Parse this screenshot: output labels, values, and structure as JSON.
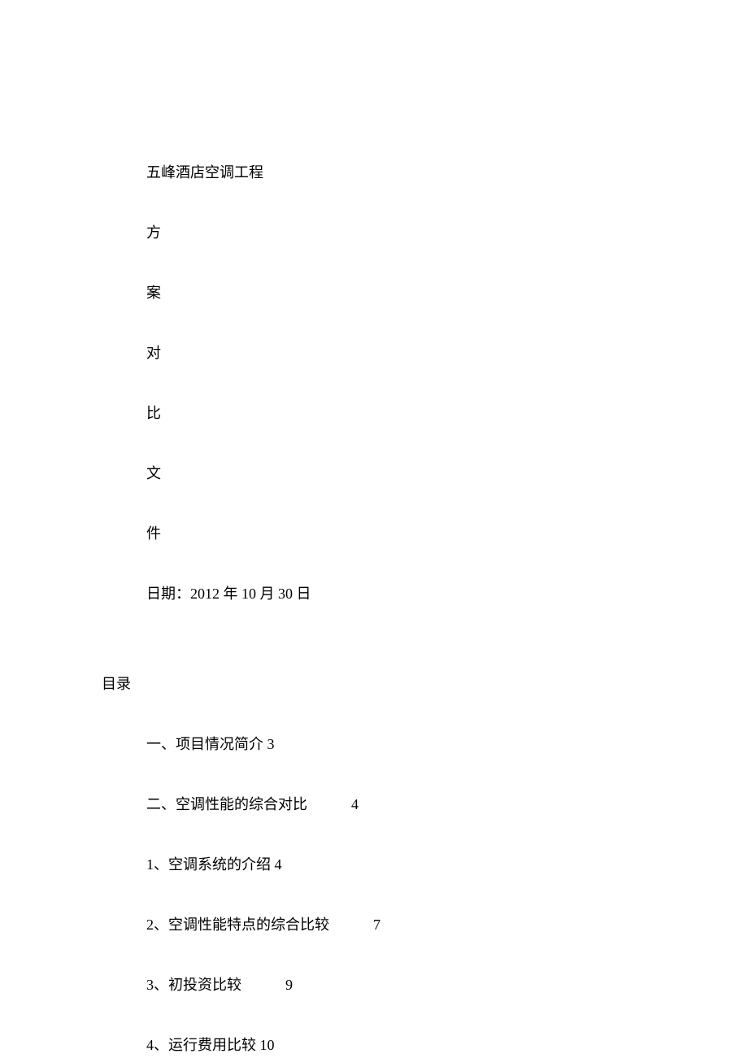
{
  "title": "五峰酒店空调工程",
  "vertical_chars": [
    "方",
    "案",
    "对",
    "比",
    "文",
    "件"
  ],
  "date_label": "日期：",
  "date_value": "2012 年 10 月 30 日",
  "toc_header": "目录",
  "toc_items": [
    {
      "text": "一、项目情况简介",
      "page": "3",
      "gap": "none"
    },
    {
      "text": "二、空调性能的综合对比",
      "page": "4",
      "gap": "medium"
    },
    {
      "text": "1、空调系统的介绍",
      "page": "4",
      "gap": "none"
    },
    {
      "text": "2、空调性能特点的综合比较",
      "page": "7",
      "gap": "large"
    },
    {
      "text": "3、初投资比较",
      "page": "9",
      "gap": "medium"
    },
    {
      "text": "4、运行费用比较",
      "page": "10",
      "gap": "none"
    }
  ]
}
